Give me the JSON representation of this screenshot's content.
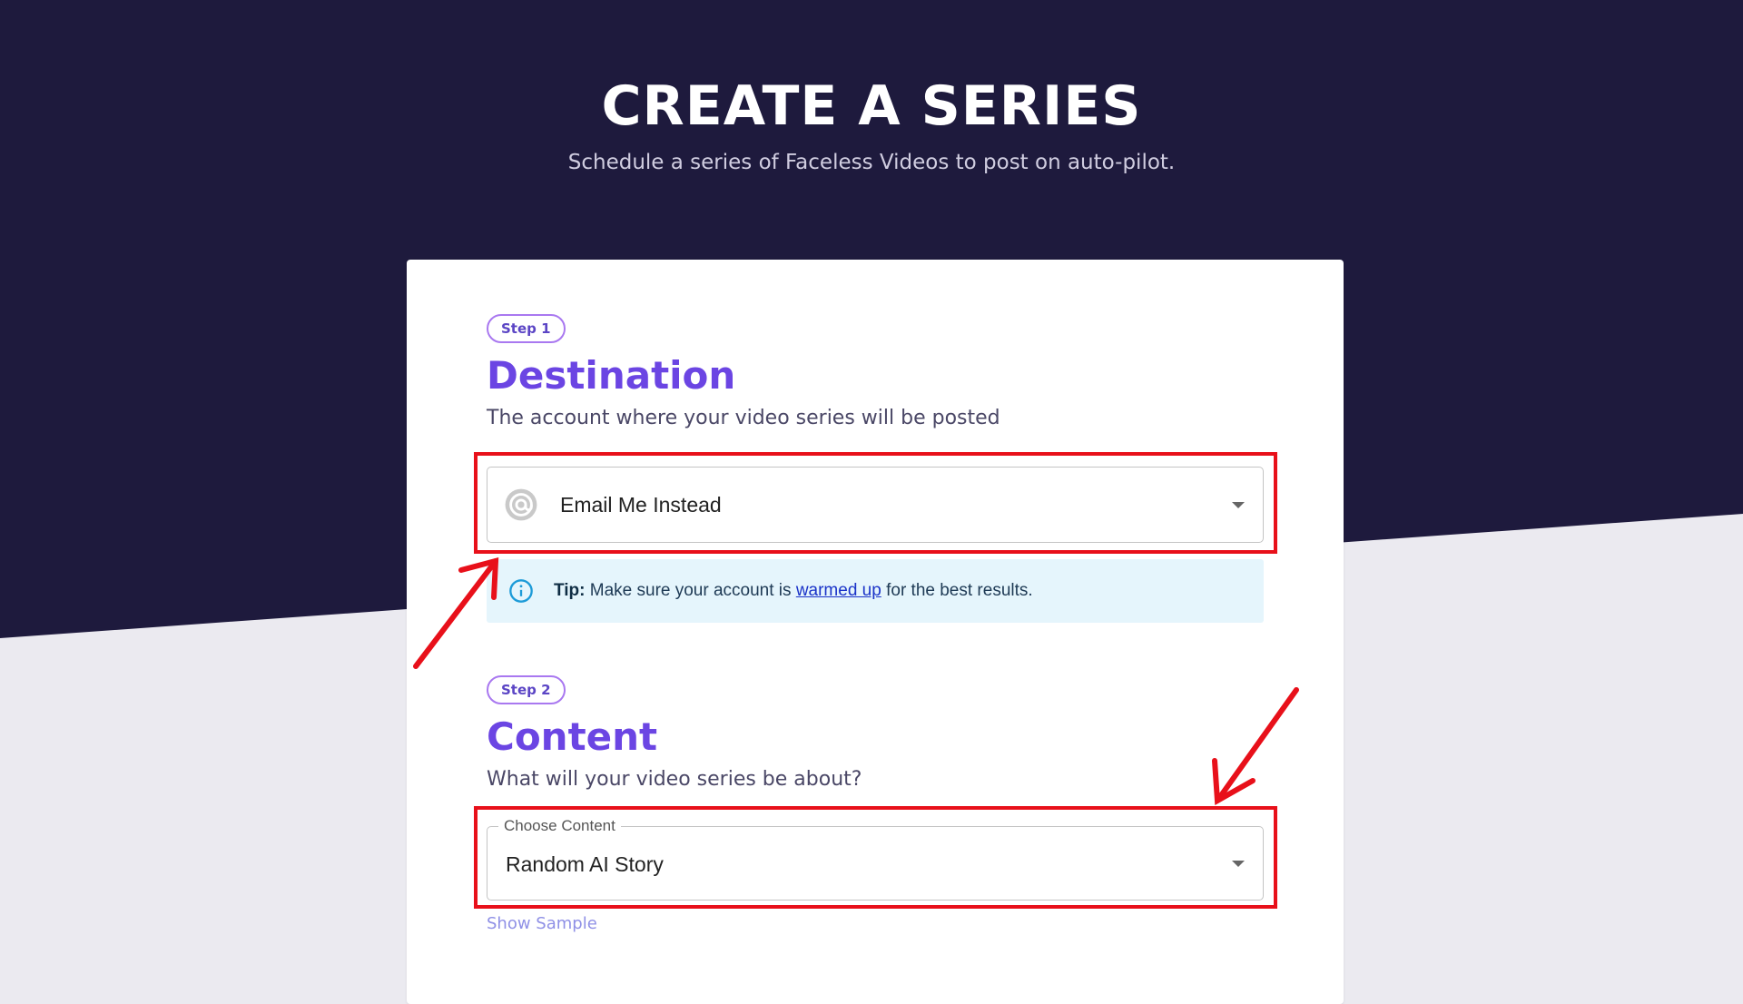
{
  "hero": {
    "title": "CREATE A SERIES",
    "subtitle": "Schedule a series of Faceless Videos to post on auto-pilot."
  },
  "step1": {
    "badge": "Step 1",
    "title": "Destination",
    "description": "The account where your video series will be posted",
    "select": {
      "value": "Email Me Instead",
      "icon": "at-sign-icon"
    },
    "tip": {
      "label": "Tip:",
      "text_before": "Make sure your account is",
      "link": "warmed up",
      "text_after": "for the best results.",
      "icon": "info-icon"
    }
  },
  "step2": {
    "badge": "Step 2",
    "title": "Content",
    "description": "What will your video series be about?",
    "select": {
      "label": "Choose Content",
      "value": "Random AI Story"
    },
    "show_sample": "Show Sample"
  },
  "colors": {
    "hero_background": "#1e1a3d",
    "page_background": "#ebeaf0",
    "accent_purple": "#6b45e3",
    "annotation_red": "#e8101a",
    "tip_background": "#e5f5fc",
    "link_blue": "#1a33c8"
  }
}
